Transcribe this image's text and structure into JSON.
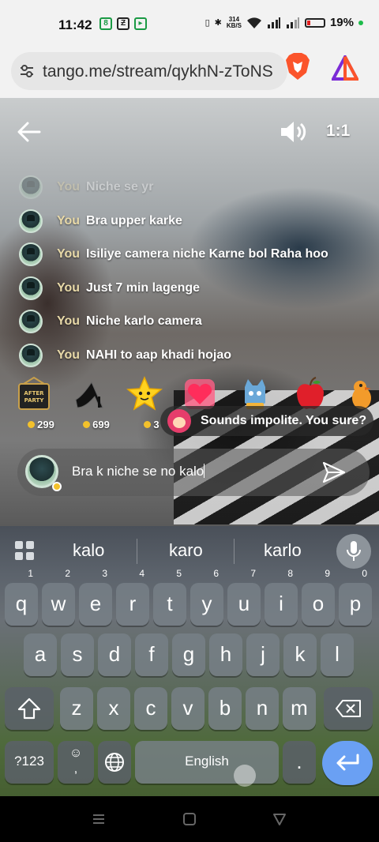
{
  "status_bar": {
    "time": "11:42",
    "net_rate_top": "314",
    "net_rate_bottom": "KB/S",
    "battery_pct": "19%"
  },
  "browser": {
    "url": "tango.me/stream/qykhN-zToNS"
  },
  "stream": {
    "ratio_label": "1:1",
    "messages": [
      {
        "who": "You",
        "text": "Niche se yr",
        "faded": true
      },
      {
        "who": "You",
        "text": "Bra upper karke"
      },
      {
        "who": "You",
        "text": "Isiliye camera niche Karne bol Raha hoo"
      },
      {
        "who": "You",
        "text": "Just 7 min lagenge"
      },
      {
        "who": "You",
        "text": "Niche karlo camera"
      },
      {
        "who": "You",
        "text": "NAHI to aap khadi hojao"
      }
    ],
    "gifts": [
      {
        "name": "after-party-gift",
        "price": "299",
        "label": "AFTER PARTY"
      },
      {
        "name": "high-heel-gift",
        "price": "699"
      },
      {
        "name": "star-gift",
        "price": "3"
      },
      {
        "name": "heart-gift",
        "price": ""
      },
      {
        "name": "cat-gift",
        "price": ""
      },
      {
        "name": "apple-gift",
        "price": ""
      },
      {
        "name": "bird-gift",
        "price": ""
      }
    ],
    "warning": "Sounds impolite. You sure?",
    "input_value": "Bra k niche se no kalo"
  },
  "keyboard": {
    "suggestions": [
      "kalo",
      "karo",
      "karlo"
    ],
    "row1": [
      {
        "k": "q",
        "n": "1"
      },
      {
        "k": "w",
        "n": "2"
      },
      {
        "k": "e",
        "n": "3"
      },
      {
        "k": "r",
        "n": "4"
      },
      {
        "k": "t",
        "n": "5"
      },
      {
        "k": "y",
        "n": "6"
      },
      {
        "k": "u",
        "n": "7"
      },
      {
        "k": "i",
        "n": "8"
      },
      {
        "k": "o",
        "n": "9"
      },
      {
        "k": "p",
        "n": "0"
      }
    ],
    "row2": [
      "a",
      "s",
      "d",
      "f",
      "g",
      "h",
      "j",
      "k",
      "l"
    ],
    "row3": [
      "z",
      "x",
      "c",
      "v",
      "b",
      "n",
      "m"
    ],
    "sym_label": "?123",
    "comma_label": ",",
    "space_label": "English",
    "period_label": "."
  },
  "colors": {
    "accent_blue": "#6aa0f3",
    "coin_gold": "#f3c12b",
    "brave_orange": "#fb542b"
  }
}
